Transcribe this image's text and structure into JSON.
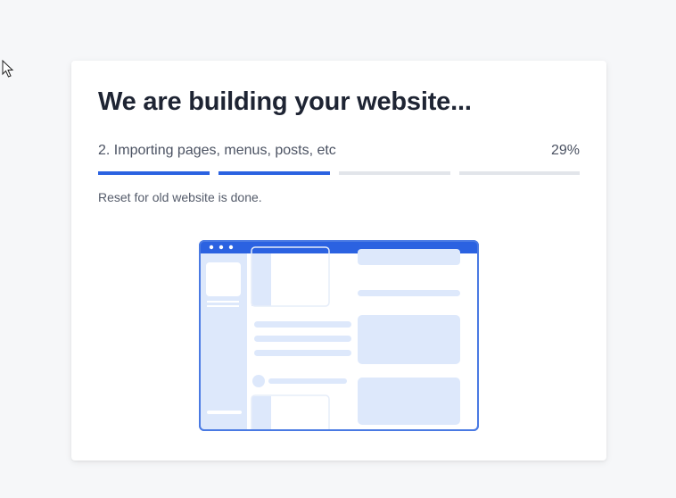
{
  "header": {
    "title": "We are building your website..."
  },
  "progress": {
    "step_label": "2. Importing pages, menus, posts, etc",
    "percent_text": "29%",
    "percent": 29,
    "segments_total": 4,
    "segments_done": 2,
    "status_message": "Reset for old website is done."
  },
  "icons": {
    "cursor": "mouse-pointer-icon",
    "illustration": "website-browser-illustration"
  },
  "colors": {
    "accent": "#2b62e1",
    "track": "#e2e5ea",
    "illustration_fill": "#dde8fb",
    "illustration_stroke": "#4a7ae3"
  }
}
